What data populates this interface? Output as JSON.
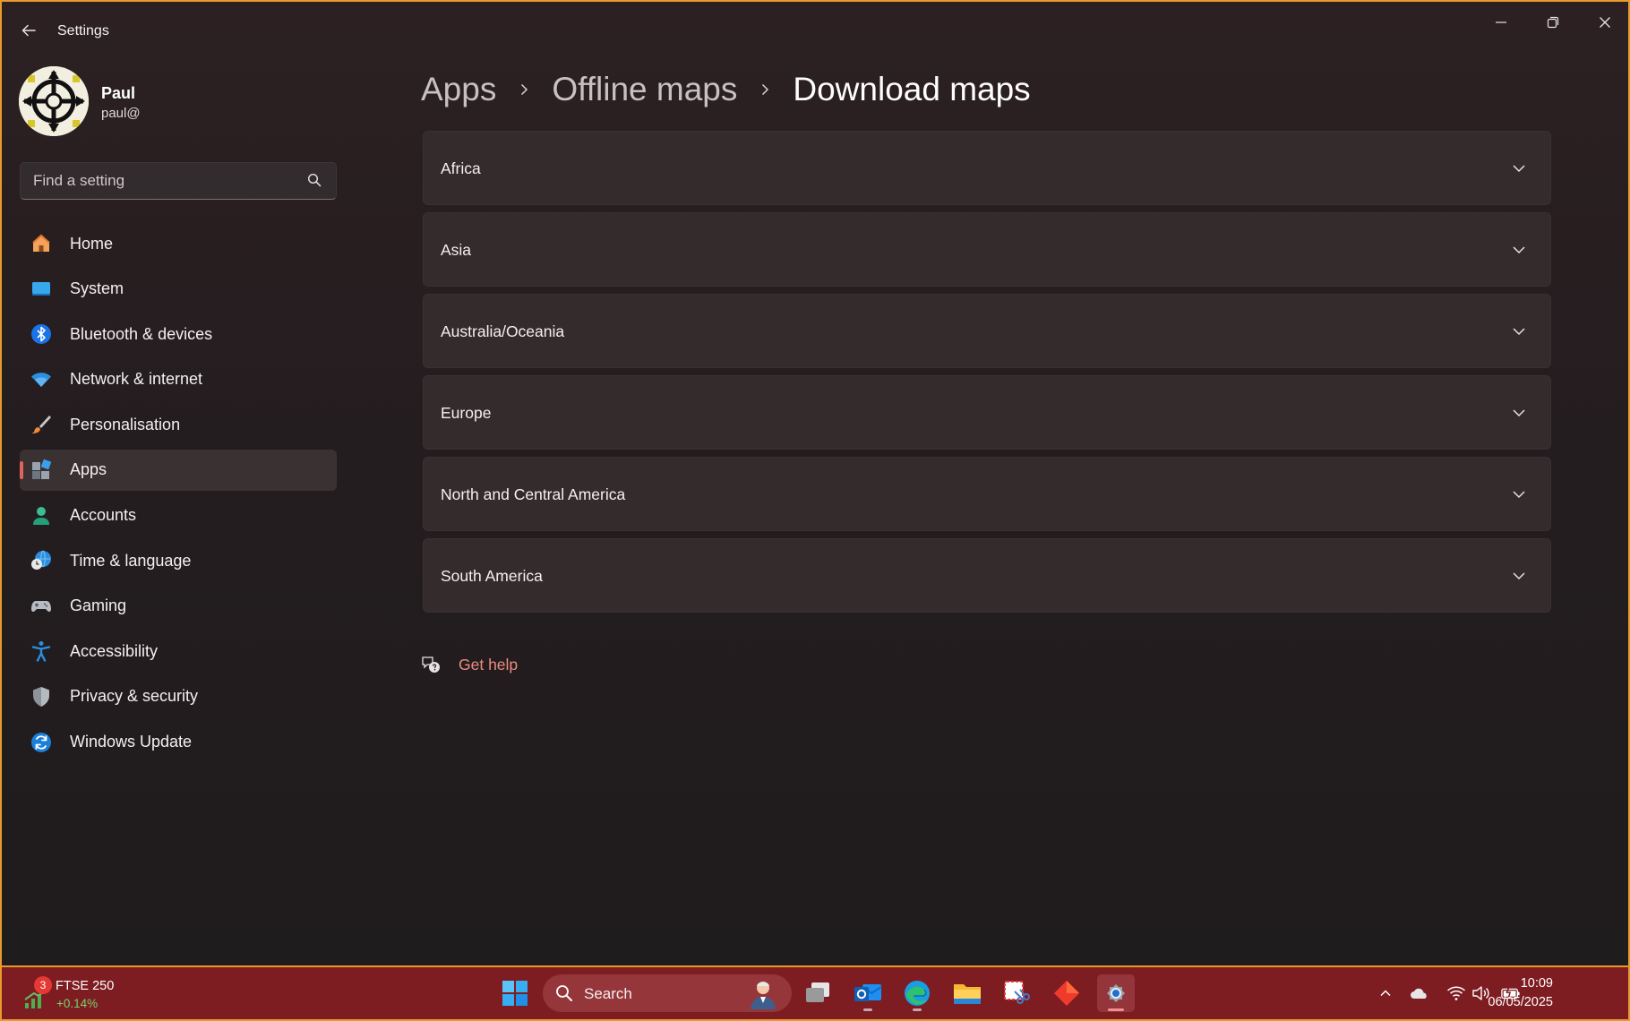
{
  "window": {
    "title": "Settings",
    "accent_color": "#e0635e",
    "link_color": "#ef8b82"
  },
  "profile": {
    "name": "Paul",
    "email": "paul@"
  },
  "search": {
    "placeholder": "Find a setting"
  },
  "sidebar": {
    "items": [
      {
        "label": "Home",
        "icon": "home-icon",
        "selected": false
      },
      {
        "label": "System",
        "icon": "system-icon",
        "selected": false
      },
      {
        "label": "Bluetooth & devices",
        "icon": "bluetooth-icon",
        "selected": false
      },
      {
        "label": "Network & internet",
        "icon": "wifi-icon",
        "selected": false
      },
      {
        "label": "Personalisation",
        "icon": "paintbrush-icon",
        "selected": false
      },
      {
        "label": "Apps",
        "icon": "apps-icon",
        "selected": true
      },
      {
        "label": "Accounts",
        "icon": "person-icon",
        "selected": false
      },
      {
        "label": "Time & language",
        "icon": "globe-clock-icon",
        "selected": false
      },
      {
        "label": "Gaming",
        "icon": "gamepad-icon",
        "selected": false
      },
      {
        "label": "Accessibility",
        "icon": "accessibility-icon",
        "selected": false
      },
      {
        "label": "Privacy & security",
        "icon": "shield-icon",
        "selected": false
      },
      {
        "label": "Windows Update",
        "icon": "update-icon",
        "selected": false
      }
    ]
  },
  "breadcrumb": {
    "items": [
      "Apps",
      "Offline maps"
    ],
    "current": "Download maps"
  },
  "regions": [
    {
      "label": "Africa"
    },
    {
      "label": "Asia"
    },
    {
      "label": "Australia/Oceania"
    },
    {
      "label": "Europe"
    },
    {
      "label": "North and Central America"
    },
    {
      "label": "South America"
    }
  ],
  "help": {
    "label": "Get help"
  },
  "taskbar": {
    "widget": {
      "badge": "3",
      "name": "FTSE 250",
      "change": "+0.14%",
      "change_color": "#79d36c"
    },
    "search_label": "Search",
    "apps": [
      "start-icon",
      "task-view-icon",
      "outlook-icon",
      "edge-icon",
      "file-explorer-icon",
      "snipping-tool-icon",
      "red-diamond-app-icon",
      "settings-icon"
    ],
    "clock": {
      "time": "10:09",
      "date": "06/05/2025"
    }
  }
}
